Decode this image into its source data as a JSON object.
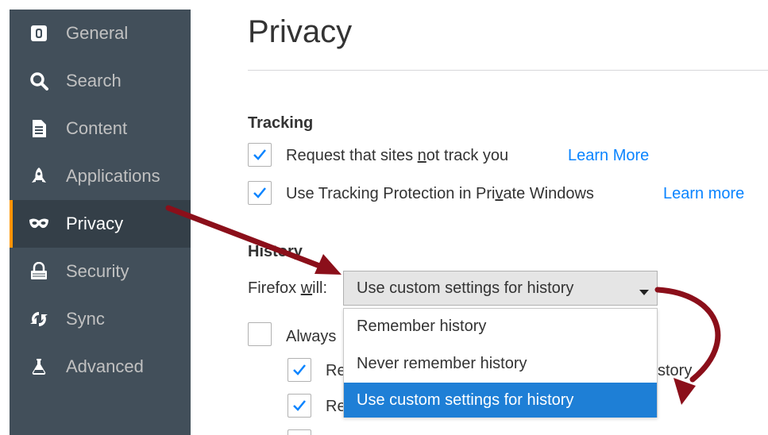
{
  "sidebar": {
    "items": [
      {
        "label": "General",
        "icon": "general-icon"
      },
      {
        "label": "Search",
        "icon": "search-icon"
      },
      {
        "label": "Content",
        "icon": "content-icon"
      },
      {
        "label": "Applications",
        "icon": "applications-icon"
      },
      {
        "label": "Privacy",
        "icon": "privacy-mask-icon",
        "selected": true
      },
      {
        "label": "Security",
        "icon": "security-icon"
      },
      {
        "label": "Sync",
        "icon": "sync-icon"
      },
      {
        "label": "Advanced",
        "icon": "advanced-icon"
      }
    ]
  },
  "main": {
    "title": "Privacy",
    "tracking": {
      "heading": "Tracking",
      "dnt": {
        "pre": "Request that sites ",
        "key": "n",
        "post": "ot track you",
        "checked": true,
        "link": "Learn More"
      },
      "tp": {
        "pre": "Use Tracking Protection in Pri",
        "key": "v",
        "post": "ate Windows",
        "checked": true,
        "link": "Learn more"
      }
    },
    "history": {
      "heading": "History",
      "firefox_will": {
        "pre": "Firefox ",
        "key": "w",
        "post": "ill:"
      },
      "select_value": "Use custom settings for history",
      "options": [
        "Remember history",
        "Never remember history",
        "Use custom settings for history"
      ],
      "highlighted_index": 2,
      "always_label": "Always",
      "sub1": {
        "prefix": "Re",
        "suffix": "story",
        "checked": true
      },
      "sub2": {
        "prefix": "Re",
        "checked": true
      }
    }
  },
  "colors": {
    "sidebar_bg": "#424f5a",
    "sidebar_selected_bg": "#343f48",
    "selected_indicator": "#ff9500",
    "link": "#0a84ff",
    "highlight": "#1e7fd6",
    "checkmark": "#0a84ff",
    "annotation_arrow": "#8b0f1a"
  }
}
